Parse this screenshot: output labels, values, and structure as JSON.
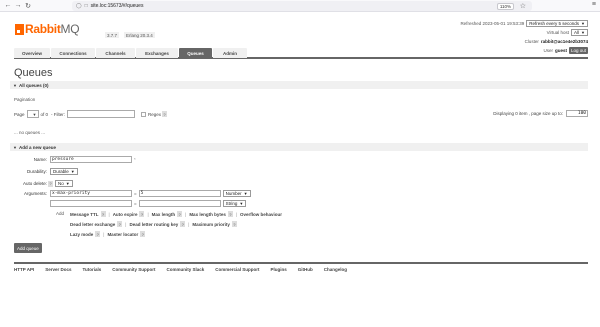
{
  "browser": {
    "url": "site.loc:15673/#/queues",
    "zoom": "110%"
  },
  "header": {
    "logo_main": "Rabbit",
    "logo_mq": "MQ",
    "version": "3.7.7",
    "erlang": "Erlang 20.3.4",
    "refreshed_label": "Refreshed 2023-05-01 19:53:39",
    "refresh_select": "Refresh every 5 seconds",
    "vhost_label": "Virtual host",
    "vhost_value": "All",
    "cluster_label": "Cluster",
    "cluster_value": "rabbit@ac1e4e2b3074",
    "user_label": "User",
    "user_value": "guest",
    "logout_label": "Log out"
  },
  "tabs": [
    {
      "label": "Overview"
    },
    {
      "label": "Connections"
    },
    {
      "label": "Channels"
    },
    {
      "label": "Exchanges"
    },
    {
      "label": "Queues"
    },
    {
      "label": "Admin"
    }
  ],
  "page_title": "Queues",
  "all_queues": {
    "heading": "All queues (0)",
    "pagination_label": "Pagination",
    "page_label": "Page",
    "of_label": "of 0",
    "filter_label": "- Filter:",
    "regex_label": "Regex",
    "help_q": "?",
    "displaying": "Displaying 0 item , page size up to:",
    "page_size": "100",
    "no_queues": "... no queues ..."
  },
  "add_queue": {
    "heading": "Add a new queue",
    "name_label": "Name:",
    "name_value": "pressure",
    "required_mark": "*",
    "durability_label": "Durability:",
    "durability_value": "Durable",
    "auto_delete_label": "Auto delete:",
    "auto_delete_value": "No",
    "arguments_label": "Arguments:",
    "arg1_key": "x-max-priority",
    "equals": "=",
    "arg1_value": "5",
    "arg1_type": "Number",
    "arg2_type": "String",
    "add_label": "Add",
    "chips_row1": [
      "Message TTL",
      "Auto expire",
      "Max length",
      "Max length bytes",
      "Overflow behaviour"
    ],
    "chips_row2": [
      "Dead letter exchange",
      "Dead letter routing key",
      "Maximum priority"
    ],
    "chips_row3": [
      "Lazy mode",
      "Master locator"
    ],
    "submit_label": "Add queue"
  },
  "footer": [
    "HTTP API",
    "Server Docs",
    "Tutorials",
    "Community Support",
    "Community Slack",
    "Commercial Support",
    "Plugins",
    "GitHub",
    "Changelog"
  ]
}
